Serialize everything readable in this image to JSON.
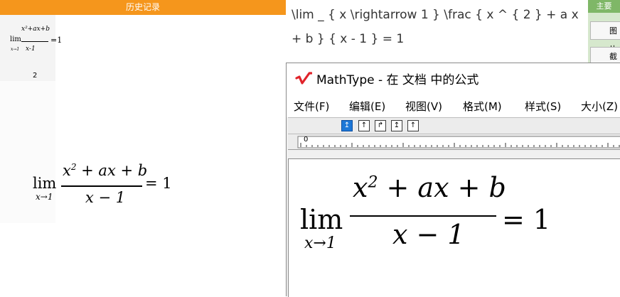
{
  "history": {
    "header": "历史记录",
    "index_label": "2",
    "thumbnail": {
      "lim": "lim",
      "sub": "x→1",
      "num": "x²+ax+b",
      "den": "x-1",
      "eq": "=1"
    },
    "formula": {
      "lim": "lim",
      "sub": "x→1",
      "num_a": "x",
      "num_sup": "2",
      "num_b": " + ax + b",
      "den": "x − 1",
      "eq": "= 1"
    }
  },
  "latex_source": "\\lim _ { x \\rightarrow 1 } \\frac { x ^ { 2 } + a x + b } { x - 1 } = 1",
  "right_panel": {
    "tab": "主要",
    "buttons": [
      "图片",
      "截图"
    ]
  },
  "mathtype": {
    "title": "MathType - 在 文档 中的公式",
    "menu": [
      "文件(F)",
      "编辑(E)",
      "视图(V)",
      "格式(M)",
      "样式(S)",
      "大小(Z)"
    ],
    "ruler_zero": "0",
    "formula": {
      "lim": "lim",
      "sub": "x→1",
      "num_a": "x",
      "num_sup": "2",
      "num_b": " + ax + b",
      "den": "x − 1",
      "eq": "= 1"
    }
  },
  "colors": {
    "history_header": "#f5961c",
    "nudge_active": "#1e78d7",
    "logo_red": "#e0232a",
    "side_tab": "#7fb767"
  }
}
